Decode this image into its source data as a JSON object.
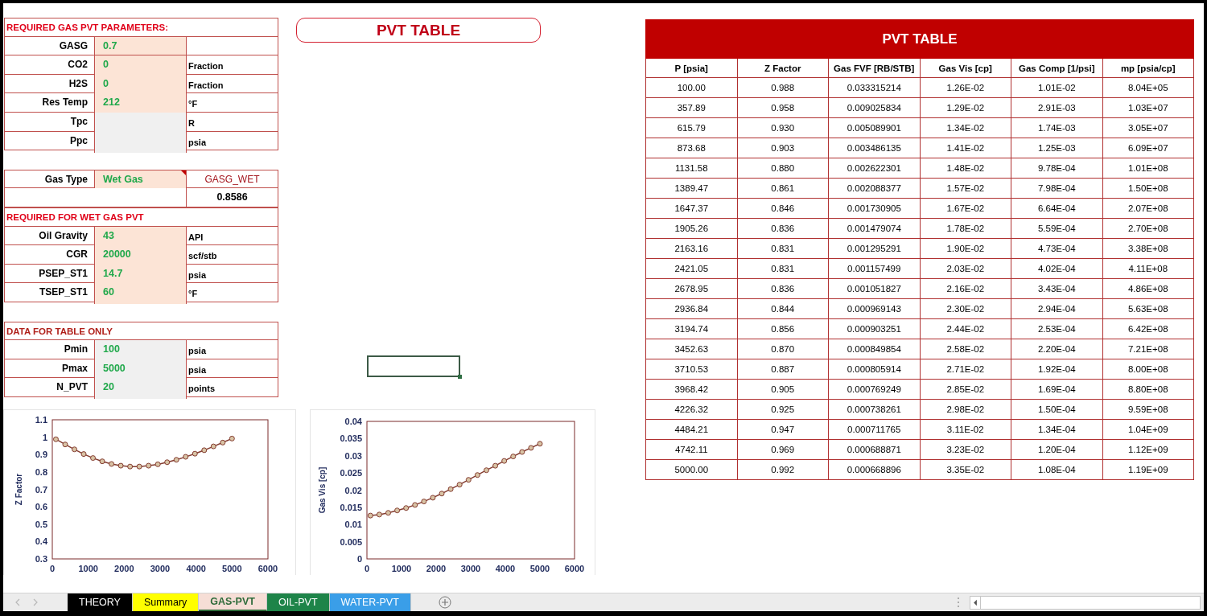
{
  "parameters": [
    {
      "kind": "params",
      "title": "REQUIRED GAS PVT PARAMETERS:",
      "rows": [
        {
          "label": "GASG",
          "value": "0.7",
          "unit": "",
          "kind": "input"
        },
        {
          "label": "CO2",
          "value": "0",
          "unit": "Fraction",
          "kind": "input"
        },
        {
          "label": "H2S",
          "value": "0",
          "unit": "Fraction",
          "kind": "input"
        },
        {
          "label": "Res Temp",
          "value": "212",
          "unit": "°F",
          "kind": "input"
        },
        {
          "label": "Tpc",
          "value": "",
          "unit": "R",
          "kind": "calc"
        },
        {
          "label": "Ppc",
          "value": "",
          "unit": "psia",
          "kind": "calc"
        }
      ]
    },
    {
      "kind": "gas_type",
      "label": "Gas Type",
      "value": "Wet Gas",
      "has_comment": true,
      "result_label": "GASG_WET",
      "result": "0.8586"
    },
    {
      "kind": "params",
      "title": "REQUIRED FOR WET GAS PVT",
      "rows": [
        {
          "label": "Oil Gravity",
          "value": "43",
          "unit": "API",
          "kind": "input"
        },
        {
          "label": "CGR",
          "value": "20000",
          "unit": "scf/stb",
          "kind": "input"
        },
        {
          "label": "PSEP_ST1",
          "value": "14.7",
          "unit": "psia",
          "kind": "input"
        },
        {
          "label": "TSEP_ST1",
          "value": "60",
          "unit": "°F",
          "kind": "input"
        }
      ]
    },
    {
      "kind": "params",
      "title": "DATA FOR TABLE ONLY",
      "rows": [
        {
          "label": "Pmin",
          "value": "100",
          "unit": "psia",
          "kind": "calc"
        },
        {
          "label": "Pmax",
          "value": "5000",
          "unit": "psia",
          "kind": "calc"
        },
        {
          "label": "N_PVT",
          "value": "20",
          "unit": "points",
          "kind": "calc"
        }
      ]
    }
  ],
  "middle_title": "PVT TABLE",
  "charts": [
    {
      "chart_data": {
        "type": "line",
        "ylabel": "Z Factor",
        "x": [
          100,
          357.89,
          615.79,
          873.68,
          1131.58,
          1389.47,
          1647.37,
          1905.26,
          2163.16,
          2421.05,
          2678.95,
          2936.84,
          3194.74,
          3452.63,
          3710.53,
          3968.42,
          4226.32,
          4484.21,
          4742.11,
          5000
        ],
        "series": [
          {
            "color": "#843c30",
            "marker": "circle",
            "values": [
              0.988,
              0.958,
              0.93,
              0.903,
              0.88,
              0.861,
              0.846,
              0.836,
              0.831,
              0.831,
              0.836,
              0.844,
              0.856,
              0.87,
              0.887,
              0.905,
              0.925,
              0.947,
              0.969,
              0.992
            ]
          }
        ],
        "xlim": [
          0,
          6000
        ],
        "ylim": [
          0.3,
          1.1
        ],
        "xticks": [
          0,
          1000,
          2000,
          3000,
          4000,
          5000,
          6000
        ],
        "yticks": [
          0.3,
          0.4,
          0.5,
          0.6,
          0.7,
          0.8,
          0.9,
          1,
          1.1
        ]
      }
    },
    {
      "chart_data": {
        "type": "line",
        "ylabel": "Gas Vis [cp]",
        "x": [
          100,
          357.89,
          615.79,
          873.68,
          1131.58,
          1389.47,
          1647.37,
          1905.26,
          2163.16,
          2421.05,
          2678.95,
          2936.84,
          3194.74,
          3452.63,
          3710.53,
          3968.42,
          4226.32,
          4484.21,
          4742.11,
          5000
        ],
        "series": [
          {
            "color": "#843c30",
            "marker": "circle",
            "values": [
              0.0126,
              0.0129,
              0.0134,
              0.0141,
              0.0148,
              0.0157,
              0.0167,
              0.0178,
              0.019,
              0.0203,
              0.0216,
              0.023,
              0.0244,
              0.0258,
              0.0271,
              0.0285,
              0.0298,
              0.0311,
              0.0323,
              0.0335
            ]
          }
        ],
        "xlim": [
          0,
          6000
        ],
        "ylim": [
          0,
          0.04
        ],
        "xticks": [
          0,
          1000,
          2000,
          3000,
          4000,
          5000,
          6000
        ],
        "yticks": [
          0,
          0.005,
          0.01,
          0.015,
          0.02,
          0.025,
          0.03,
          0.035,
          0.04
        ]
      }
    }
  ],
  "table": {
    "title": "PVT TABLE",
    "columns": [
      "P [psia]",
      "Z Factor",
      "Gas FVF [RB/STB]",
      "Gas Vis [cp]",
      "Gas Comp [1/psi]",
      "mp [psia/cp]"
    ],
    "rows": [
      [
        "100.00",
        "0.988",
        "0.033315214",
        "1.26E-02",
        "1.01E-02",
        "8.04E+05"
      ],
      [
        "357.89",
        "0.958",
        "0.009025834",
        "1.29E-02",
        "2.91E-03",
        "1.03E+07"
      ],
      [
        "615.79",
        "0.930",
        "0.005089901",
        "1.34E-02",
        "1.74E-03",
        "3.05E+07"
      ],
      [
        "873.68",
        "0.903",
        "0.003486135",
        "1.41E-02",
        "1.25E-03",
        "6.09E+07"
      ],
      [
        "1131.58",
        "0.880",
        "0.002622301",
        "1.48E-02",
        "9.78E-04",
        "1.01E+08"
      ],
      [
        "1389.47",
        "0.861",
        "0.002088377",
        "1.57E-02",
        "7.98E-04",
        "1.50E+08"
      ],
      [
        "1647.37",
        "0.846",
        "0.001730905",
        "1.67E-02",
        "6.64E-04",
        "2.07E+08"
      ],
      [
        "1905.26",
        "0.836",
        "0.001479074",
        "1.78E-02",
        "5.59E-04",
        "2.70E+08"
      ],
      [
        "2163.16",
        "0.831",
        "0.001295291",
        "1.90E-02",
        "4.73E-04",
        "3.38E+08"
      ],
      [
        "2421.05",
        "0.831",
        "0.001157499",
        "2.03E-02",
        "4.02E-04",
        "4.11E+08"
      ],
      [
        "2678.95",
        "0.836",
        "0.001051827",
        "2.16E-02",
        "3.43E-04",
        "4.86E+08"
      ],
      [
        "2936.84",
        "0.844",
        "0.000969143",
        "2.30E-02",
        "2.94E-04",
        "5.63E+08"
      ],
      [
        "3194.74",
        "0.856",
        "0.000903251",
        "2.44E-02",
        "2.53E-04",
        "6.42E+08"
      ],
      [
        "3452.63",
        "0.870",
        "0.000849854",
        "2.58E-02",
        "2.20E-04",
        "7.21E+08"
      ],
      [
        "3710.53",
        "0.887",
        "0.000805914",
        "2.71E-02",
        "1.92E-04",
        "8.00E+08"
      ],
      [
        "3968.42",
        "0.905",
        "0.000769249",
        "2.85E-02",
        "1.69E-04",
        "8.80E+08"
      ],
      [
        "4226.32",
        "0.925",
        "0.000738261",
        "2.98E-02",
        "1.50E-04",
        "9.59E+08"
      ],
      [
        "4484.21",
        "0.947",
        "0.000711765",
        "3.11E-02",
        "1.34E-04",
        "1.04E+09"
      ],
      [
        "4742.11",
        "0.969",
        "0.000688871",
        "3.23E-02",
        "1.20E-04",
        "1.12E+09"
      ],
      [
        "5000.00",
        "0.992",
        "0.000668896",
        "3.35E-02",
        "1.08E-04",
        "1.19E+09"
      ]
    ]
  },
  "sheet_tabs": [
    {
      "label": "THEORY",
      "selected": false,
      "color": "#000000"
    },
    {
      "label": "Summary",
      "selected": false,
      "color": "#ffff00"
    },
    {
      "label": "GAS-PVT",
      "selected": true,
      "color": "#f6ded6"
    },
    {
      "label": "OIL-PVT",
      "selected": false,
      "color": "#1e8449"
    },
    {
      "label": "WATER-PVT",
      "selected": false,
      "color": "#3a9ee8"
    }
  ]
}
